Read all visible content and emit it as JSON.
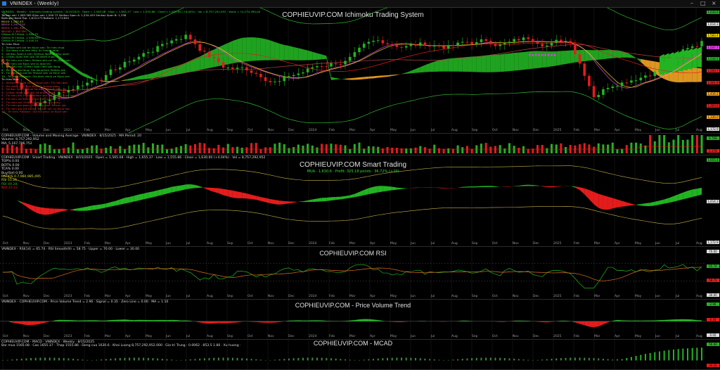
{
  "window": {
    "title": "VNINDEX - (Weekly)",
    "controls": [
      "–",
      "□",
      "×"
    ]
  },
  "colors": {
    "green": "#22b422",
    "red": "#e51c1c",
    "orange": "#f5a623",
    "yellow": "#e8d000",
    "magenta": "#e040e0",
    "grid": "#222222"
  },
  "x_axis": {
    "labels": [
      "Oct",
      "Nov",
      "Dec",
      "2023",
      "Feb",
      "Mar",
      "Apr",
      "May",
      "Jun",
      "Jul",
      "Aug",
      "Sep",
      "Oct",
      "Nov",
      "Dec",
      "2024",
      "Feb",
      "Mar",
      "Apr",
      "May",
      "Jun",
      "Jul",
      "Aug",
      "Sep",
      "Oct",
      "Nov",
      "Dec",
      "2025",
      "Feb",
      "Mar",
      "Apr",
      "May",
      "Jun",
      "Jul",
      "Aug"
    ]
  },
  "panes": [
    {
      "id": "ichimoku",
      "title": "COPHIEUVIP.COM Ichimoku Trading System",
      "header_lines": [
        {
          "text": "VNINDEX - Weekly · Ichimoku trading system · 8/15/2025 · Open = 1,565.08 · High = 1,655.37 · Low = 1,555.86 · Close = 1,630.60 (+4.04%) · Vol = 8,757,292,952 · Value = 14,274,390,00",
          "color": "#33dd33"
        },
        {
          "text": "Tenkan sen 1,563.585  Kijun sen 1,500.73  Senkou Span A: 1,534.455  Senkou Span B: 1,336",
          "color": "#dddddd"
        },
        {
          "text": "Bollinger Band Top: 1,614.273  Bottom: 1,172.891",
          "color": "#dddddd"
        },
        {
          "text": "MA10: 1,583.43",
          "color": "#dddd33"
        },
        {
          "text": "MA20: 1,547.714",
          "color": "#dd66dd"
        },
        {
          "text": "MA50: 1,461.909",
          "color": "#dd4444"
        },
        {
          "text": "MA100: 1,363.595",
          "color": "#dd4444"
        },
        {
          "text": "Chikou M Chikou: 1,596.75",
          "color": "#33dd33"
        },
        {
          "text": "Chikou M Chikou: 1,536.853",
          "color": "#33dd33"
        },
        {
          "text": "Chikou M Chikou: 1,416.24",
          "color": "#33dd33"
        }
      ],
      "signals": [
        {
          "text": "Tin hieu Mua:",
          "color": "#dddddd"
        },
        {
          "text": "1 - Tenkan sen cat len Kijun sen: Tin hieu mua",
          "color": "#33dd33"
        },
        {
          "text": "2 - Gia dong cua tren May: Xu huong tang",
          "color": "#33dd33"
        },
        {
          "text": "3 - Senkou Span A tren Senkou Span B: May xanh",
          "color": "#33dd33"
        },
        {
          "text": "4 - Chikou Span tren gia 26 phien truoc",
          "color": "#33dd33"
        },
        {
          "text": "5 - Tin hieu xac nhan: Tenkan sen cat len Kijun sen",
          "color": "#33dd33"
        },
        {
          "text": "6 - Tin hieu cat Kijun sen tu duoi len",
          "color": "#33dd33"
        },
        {
          "text": "7 - Tin hieu cat: Chikou Span tren gia dong",
          "color": "#33dd33"
        },
        {
          "text": "8 - Tin hieu gia tang: Gia dong tren Tenkan sen",
          "color": "#33dd33"
        },
        {
          "text": "9 - Tin hieu gia cat len Tenkan sen va Kijun sen",
          "color": "#33dd33"
        },
        {
          "text": "10 - Tin hieu Pullback: Gia dieu chinh ve Kijun sen",
          "color": "#33dd33"
        },
        {
          "text": "Tin hieu Ban:",
          "color": "#dddddd"
        },
        {
          "text": "1 - Tenkan sen cat xuong Kijun sen: Tin hieu ban",
          "color": "#dd3333"
        },
        {
          "text": "2 - Gia dong cua duoi May: Xu huong giam",
          "color": "#dd3333"
        },
        {
          "text": "3 - Senkou Span A duoi Senkou Span B: May do",
          "color": "#dd3333"
        },
        {
          "text": "4 - Chikou Span duoi gia 26 phien truoc",
          "color": "#dd3333"
        },
        {
          "text": "5 - Tin hieu xac nhan: Tenkan sen cat xuong Kijun sen",
          "color": "#dd3333"
        },
        {
          "text": "6 - Tin hieu cat Kijun sen tu tren xuong",
          "color": "#dd3333"
        },
        {
          "text": "7 - Tin hieu cat: Chikou Span duoi gia dong",
          "color": "#dd3333"
        },
        {
          "text": "8 - Tin hieu gia giam: Gia dong duoi Tenkan sen",
          "color": "#dd3333"
        },
        {
          "text": "9 - Tin hieu gia cat xuong Tenkan sen va Kijun sen",
          "color": "#dd3333"
        },
        {
          "text": "10 - Tin hieu Pullback: Gia hoi phuc ve Kijun sen",
          "color": "#dd3333"
        }
      ],
      "price_labels": [
        {
          "text": "1,630.6",
          "color": "#22b422"
        },
        {
          "text": "1,614.3",
          "color": "#dddddd"
        },
        {
          "text": "1,583.4",
          "color": "#e8d000"
        },
        {
          "text": "1,547.7",
          "color": "#e040e0"
        },
        {
          "text": "1,534.5",
          "color": "#22b422"
        },
        {
          "text": "1,500.7",
          "color": "#e51c1c"
        },
        {
          "text": "1,461.9",
          "color": "#e51c1c"
        },
        {
          "text": "1,416.2",
          "color": "#f5a623"
        },
        {
          "text": "1,363.6",
          "color": "#e51c1c"
        },
        {
          "text": "1,336.0",
          "color": "#f5a623"
        },
        {
          "text": "1,172.9",
          "color": "#dddddd"
        }
      ]
    },
    {
      "id": "volume",
      "title": "",
      "header_lines": [
        {
          "text": "COPHIEUVIP.COM - Volume and Moving Average · VNINDEX · 8/15/2025 · MA Period: 20",
          "color": "#dddddd"
        },
        {
          "text": "Volume: 8,757,292,952",
          "color": "#dddddd"
        },
        {
          "text": "MA: 5,167,706,752",
          "color": "#dddddd"
        }
      ],
      "price_labels": [
        {
          "text": "8.76B",
          "color": "#22b422"
        },
        {
          "text": "5.17B",
          "color": "#e51c1c"
        }
      ]
    },
    {
      "id": "smart",
      "title": "COPHIEUVIP.COM Smart Trading",
      "sub_status": "MUA · 1,630.6 · Profit: 325.18 points · 36.72% (+24)",
      "header_lines": [
        {
          "text": "COPHIEUVIP.COM - Smart Trading · VNINDEX · 8/15/2025 · Open = 1,565.08 · High = 1,655.37 · Low = 1,555.86 · Close = 1,630.60 (+4.04%) · Vol = 8,757,292,952",
          "color": "#dddddd"
        },
        {
          "text": "TOP%   0.00",
          "color": "#dddddd"
        },
        {
          "text": "BOT%   0.00",
          "color": "#dddddd"
        },
        {
          "text": "TCA%   0.00",
          "color": "#dddddd"
        },
        {
          "text": "Buy/Sell   0.00",
          "color": "#dddddd"
        },
        {
          "text": "RATIOS   0.7,960,985,495",
          "color": "#dddd33"
        },
        {
          "text": "RSI   55.26",
          "color": "#dddd33"
        },
        {
          "text": "PDI   49.28",
          "color": "#22b422"
        },
        {
          "text": "NDI   20.13",
          "color": "#e51c1c"
        }
      ],
      "price_labels": [
        {
          "text": "1,655.4",
          "color": "#22b422"
        },
        {
          "text": "1,614.3",
          "color": "#dddddd"
        },
        {
          "text": "1,172.9",
          "color": "#dddddd"
        }
      ]
    },
    {
      "id": "rsi",
      "title": "COPHIEUVIP.COM RSI",
      "header_lines": [
        {
          "text": "VNINDEX - RSI(14) = 65.74 · RSI Smooth(9) = 58.75 · Upper = 70.00 · Lower = 30.00",
          "color": "#dddddd"
        }
      ],
      "price_labels": [
        {
          "text": "70.00",
          "color": "#dddddd"
        },
        {
          "text": "65.74",
          "color": "#22b422"
        },
        {
          "text": "58.75",
          "color": "#e51c1c"
        },
        {
          "text": "30.00",
          "color": "#dddddd"
        }
      ]
    },
    {
      "id": "pvt",
      "title": "COPHIEUVIP.COM - Price Volume Trend",
      "header_lines": [
        {
          "text": "VNINDEX - COPHIEUVIP.COM - Price Volume Trend = 2.96 · Signal = 0.35 · Zero Line = 0.00 · MA = 1.10",
          "color": "#dddddd"
        }
      ],
      "price_labels": [
        {
          "text": "2.96",
          "color": "#22b422"
        },
        {
          "text": "0.35",
          "color": "#e51c1c"
        },
        {
          "text": "0.00",
          "color": "#dddddd"
        }
      ]
    },
    {
      "id": "macd",
      "title": "COPHIEUVIP.COM - MCAD",
      "header_lines": [
        {
          "text": "COPHIEUVIP.COM - MACD · VNINDEX · Weekly · 8/15/2025",
          "color": "#dddddd"
        },
        {
          "text": "Bar mua 1565.08 · Cao 1655.37 · Thap 1555.86 · Dong cua 1630.6 · Khoi Luong 8,757,292,952.000 · Gia tri Trung · 0.0062 · 853.5 1.86 · Xu huong ·",
          "color": "#dddddd"
        }
      ],
      "price_labels": [
        {
          "text": "56.90",
          "color": "#22b422"
        },
        {
          "text": "34.20",
          "color": "#e51c1c"
        }
      ]
    }
  ]
}
